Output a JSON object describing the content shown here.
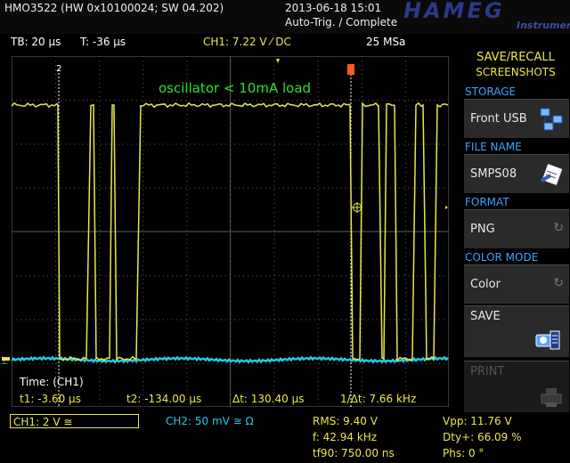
{
  "header": {
    "device_info": "HMO3522 (HW 0x10100024; SW 04.202)",
    "timestamp": "2013-06-18 15:01",
    "trigger_status": "Auto-Trig. / Complete",
    "brand": "HAMEG",
    "brand_sub": "Instruments"
  },
  "top_bar": {
    "timebase": "TB: 20 µs",
    "time_offset": "T: -36 µs",
    "ch1_setting": "CH1: 7.22 V ⁄ DC",
    "sample_rate": "25 MSa"
  },
  "screen": {
    "annotation": "oscillator < 10mA load",
    "cursor_1_label": "2",
    "time_label": "Time: (CH1)",
    "t1": "t1: -3.60 µs",
    "t2": "t2: -134.00 µs",
    "dt": "Δt: 130.40 µs",
    "inv_dt": "1/Δt: 7.66 kHz",
    "ch1_color": "#e8e84a",
    "ch2_color": "#28c8e0"
  },
  "status": {
    "ch1_scale": "CH1: 2 V ≅",
    "ch2_scale": "CH2: 50 mV ≅ Ω",
    "rms": "RMS: 9.40 V",
    "freq": "f: 42.94 kHz",
    "tf90": "tf90: 750.00 ns",
    "vpp": "Vpp: 11.76 V",
    "duty": "Dty+: 66.09 %",
    "phase": "Phs: 0 °"
  },
  "menu": {
    "title_line1": "SAVE/RECALL",
    "title_line2": "SCREENSHOTS",
    "storage_title": "STORAGE",
    "storage_value": "Front USB",
    "filename_title": "FILE NAME",
    "filename_value": "SMPS08",
    "format_title": "FORMAT",
    "format_value": "PNG",
    "color_title": "COLOR MODE",
    "color_value": "Color",
    "save_label": "SAVE",
    "print_label": "PRINT"
  }
}
